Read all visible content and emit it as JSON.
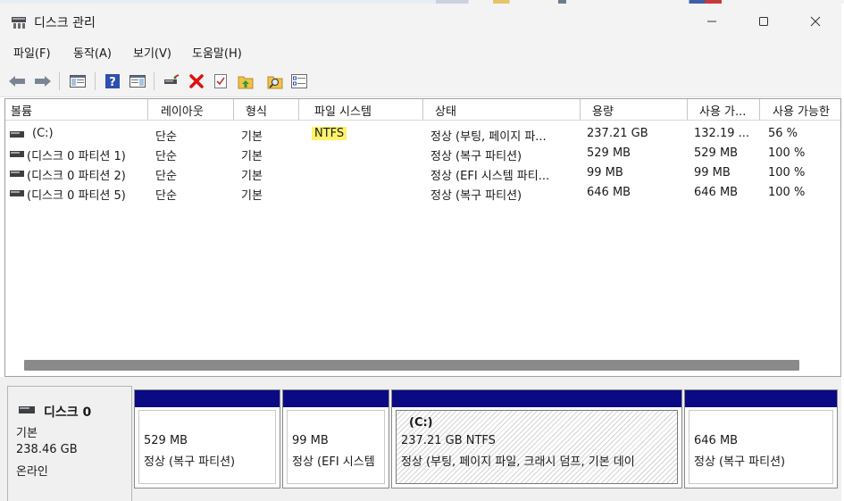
{
  "window": {
    "title": "디스크 관리"
  },
  "menu": {
    "file": "파일(F)",
    "action": "동작(A)",
    "view": "보기(V)",
    "help": "도움말(H)"
  },
  "toolbar": {
    "icons": [
      "back-arrow-icon",
      "forward-arrow-icon",
      "console-tree-icon",
      "help-icon",
      "panel-icon",
      "connect-drive-icon",
      "delete-icon",
      "check-icon",
      "up-folder-icon",
      "search-folder-icon",
      "properties-icon"
    ]
  },
  "volumes": {
    "headers": [
      "볼륨",
      "레이아웃",
      "형식",
      "파일 시스템",
      "상태",
      "용량",
      "사용 가...",
      "사용 가능한"
    ],
    "rows": [
      {
        "volume": "(C:)",
        "layout": "단순",
        "type": "기본",
        "fs": "NTFS",
        "status": "정상 (부팅, 페이지 파...",
        "capacity": "237.21 GB",
        "free": "132.19 ...",
        "pct": "56 %"
      },
      {
        "volume": "(디스크 0 파티션 1)",
        "layout": "단순",
        "type": "기본",
        "fs": "",
        "status": "정상 (복구 파티션)",
        "capacity": "529 MB",
        "free": "529 MB",
        "pct": "100 %"
      },
      {
        "volume": "(디스크 0 파티션 2)",
        "layout": "단순",
        "type": "기본",
        "fs": "",
        "status": "정상 (EFI 시스템 파티...",
        "capacity": "99 MB",
        "free": "99 MB",
        "pct": "100 %"
      },
      {
        "volume": "(디스크 0 파티션 5)",
        "layout": "단순",
        "type": "기본",
        "fs": "",
        "status": "정상 (복구 파티션)",
        "capacity": "646 MB",
        "free": "646 MB",
        "pct": "100 %"
      }
    ]
  },
  "disk": {
    "name": "디스크 0",
    "kind": "기본",
    "size": "238.46 GB",
    "state": "온라인",
    "partitions": [
      {
        "label": "",
        "size": "529 MB",
        "status": "정상 (복구 파티션)"
      },
      {
        "label": "",
        "size": "99 MB",
        "status": "정상 (EFI 시스템"
      },
      {
        "label": "(C:)",
        "size": "237.21 GB NTFS",
        "status": "정상 (부팅, 페이지 파일, 크래시 덤프, 기본 데이"
      },
      {
        "label": "",
        "size": "646 MB",
        "status": "정상 (복구 파티션)"
      }
    ]
  },
  "colors": {
    "partition_header": "#0a0a84",
    "highlight": "#fff36a",
    "delete_icon": "#e01010"
  }
}
